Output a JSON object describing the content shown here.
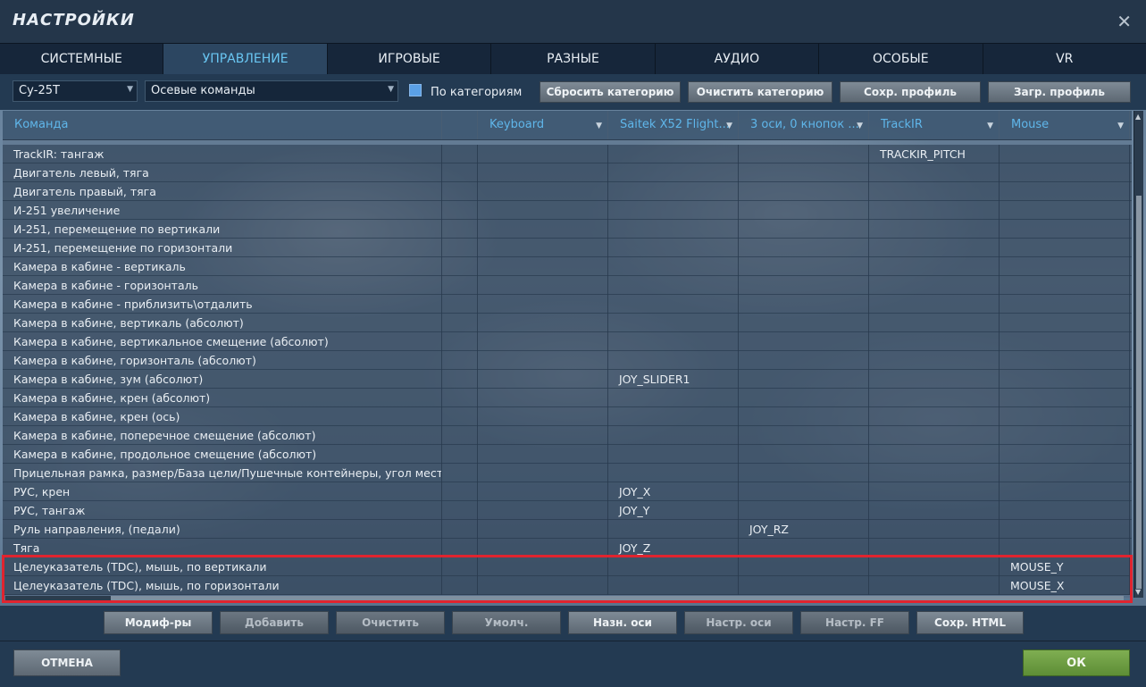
{
  "window": {
    "title": "НАСТРОЙКИ",
    "close_icon": "close-icon"
  },
  "tabs": [
    {
      "label": "СИСТЕМНЫЕ",
      "active": false
    },
    {
      "label": "УПРАВЛЕНИЕ",
      "active": true
    },
    {
      "label": "ИГРОВЫЕ",
      "active": false
    },
    {
      "label": "РАЗНЫЕ",
      "active": false
    },
    {
      "label": "АУДИО",
      "active": false
    },
    {
      "label": "ОСОБЫЕ",
      "active": false
    },
    {
      "label": "VR",
      "active": false
    }
  ],
  "filters": {
    "aircraft": "Су-25Т",
    "category": "Осевые команды",
    "by_category_label": "По категориям",
    "by_category_checked": true
  },
  "profile_buttons": {
    "reset_category": "Сбросить категорию",
    "clear_category": "Очистить категорию",
    "save_profile": "Сохр. профиль",
    "load_profile": "Загр. профиль"
  },
  "columns": {
    "command": "Команда",
    "keyboard": "Keyboard",
    "saitek": "Saitek X52 Flight...",
    "axes": "3 оси, 0 кнопок ...",
    "trackir": "TrackIR",
    "mouse": "Mouse"
  },
  "rows": [
    {
      "command": "TrackIR: тангаж",
      "keyboard": "",
      "saitek": "",
      "axes": "",
      "trackir": "TRACKIR_PITCH",
      "mouse": ""
    },
    {
      "command": "Двигатель левый, тяга",
      "keyboard": "",
      "saitek": "",
      "axes": "",
      "trackir": "",
      "mouse": ""
    },
    {
      "command": "Двигатель правый, тяга",
      "keyboard": "",
      "saitek": "",
      "axes": "",
      "trackir": "",
      "mouse": ""
    },
    {
      "command": "И-251 увеличение",
      "keyboard": "",
      "saitek": "",
      "axes": "",
      "trackir": "",
      "mouse": ""
    },
    {
      "command": "И-251, перемещение по вертикали",
      "keyboard": "",
      "saitek": "",
      "axes": "",
      "trackir": "",
      "mouse": ""
    },
    {
      "command": "И-251, перемещение по горизонтали",
      "keyboard": "",
      "saitek": "",
      "axes": "",
      "trackir": "",
      "mouse": ""
    },
    {
      "command": "Камера в кабине - вертикаль",
      "keyboard": "",
      "saitek": "",
      "axes": "",
      "trackir": "",
      "mouse": ""
    },
    {
      "command": "Камера в кабине - горизонталь",
      "keyboard": "",
      "saitek": "",
      "axes": "",
      "trackir": "",
      "mouse": ""
    },
    {
      "command": "Камера в кабине - приблизить\\отдалить",
      "keyboard": "",
      "saitek": "",
      "axes": "",
      "trackir": "",
      "mouse": ""
    },
    {
      "command": "Камера в кабине, вертикаль (абсолют)",
      "keyboard": "",
      "saitek": "",
      "axes": "",
      "trackir": "",
      "mouse": ""
    },
    {
      "command": "Камера в кабине, вертикальное смещение (абсолют)",
      "keyboard": "",
      "saitek": "",
      "axes": "",
      "trackir": "",
      "mouse": ""
    },
    {
      "command": "Камера в кабине, горизонталь (абсолют)",
      "keyboard": "",
      "saitek": "",
      "axes": "",
      "trackir": "",
      "mouse": ""
    },
    {
      "command": "Камера в кабине, зум (абсолют)",
      "keyboard": "",
      "saitek": "JOY_SLIDER1",
      "axes": "",
      "trackir": "",
      "mouse": ""
    },
    {
      "command": "Камера в кабине, крен (абсолют)",
      "keyboard": "",
      "saitek": "",
      "axes": "",
      "trackir": "",
      "mouse": ""
    },
    {
      "command": "Камера в кабине, крен (ось)",
      "keyboard": "",
      "saitek": "",
      "axes": "",
      "trackir": "",
      "mouse": ""
    },
    {
      "command": "Камера в кабине, поперечное смещение (абсолют)",
      "keyboard": "",
      "saitek": "",
      "axes": "",
      "trackir": "",
      "mouse": ""
    },
    {
      "command": "Камера в кабине, продольное смещение (абсолют)",
      "keyboard": "",
      "saitek": "",
      "axes": "",
      "trackir": "",
      "mouse": ""
    },
    {
      "command": "Прицельная рамка, размер/База цели/Пушечные контейнеры, угол места",
      "keyboard": "",
      "saitek": "",
      "axes": "",
      "trackir": "",
      "mouse": ""
    },
    {
      "command": "РУС, крен",
      "keyboard": "",
      "saitek": "JOY_X",
      "axes": "",
      "trackir": "",
      "mouse": ""
    },
    {
      "command": "РУС, тангаж",
      "keyboard": "",
      "saitek": "JOY_Y",
      "axes": "",
      "trackir": "",
      "mouse": ""
    },
    {
      "command": "Руль направления, (педали)",
      "keyboard": "",
      "saitek": "",
      "axes": "JOY_RZ",
      "trackir": "",
      "mouse": ""
    },
    {
      "command": "Тяга",
      "keyboard": "",
      "saitek": "JOY_Z",
      "axes": "",
      "trackir": "",
      "mouse": ""
    },
    {
      "command": "Целеуказатель (TDC), мышь, по вертикали",
      "keyboard": "",
      "saitek": "",
      "axes": "",
      "trackir": "",
      "mouse": "MOUSE_Y"
    },
    {
      "command": "Целеуказатель (TDC), мышь, по горизонтали",
      "keyboard": "",
      "saitek": "",
      "axes": "",
      "trackir": "",
      "mouse": "MOUSE_X"
    }
  ],
  "action_buttons": {
    "modifiers": "Модиф-ры",
    "add": "Добавить",
    "clear": "Очистить",
    "default": "Умолч.",
    "assign_axis": "Назн. оси",
    "axis_tune": "Настр. оси",
    "ff_tune": "Настр. FF",
    "save_html": "Сохр. HTML"
  },
  "footer": {
    "cancel": "ОТМЕНА",
    "ok": "ОК"
  },
  "colors": {
    "accent": "#69c6f2",
    "highlight_border": "#e0242f",
    "ok_button": "#6a9a42"
  }
}
